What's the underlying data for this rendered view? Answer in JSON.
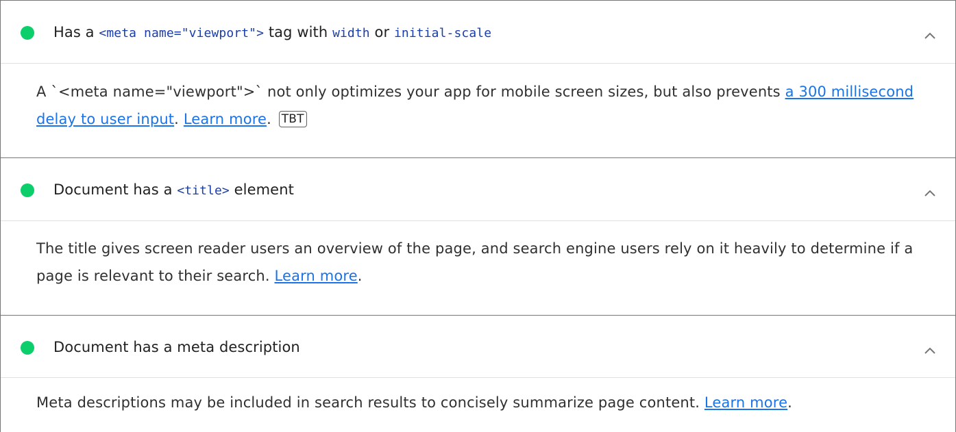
{
  "audits": [
    {
      "title_prefix": "Has a ",
      "title_code1": "<meta name=\"viewport\">",
      "title_middle": " tag with ",
      "title_code2": "width",
      "title_or": " or ",
      "title_code3": "initial-scale",
      "description_prefix": "A `<meta name=\"viewport\">` not only optimizes your app for mobile screen sizes, but also prevents ",
      "description_link1": "a 300 millisecond delay to user input",
      "description_sep": ". ",
      "learn_more": "Learn more",
      "description_end": ".",
      "badge": "TBT",
      "status_color": "#0cce6b",
      "expand_icon": "chevron-up-icon"
    },
    {
      "title_prefix": "Document has a ",
      "title_code1": "<title>",
      "title_suffix": " element",
      "description_prefix": "The title gives screen reader users an overview of the page, and search engine users rely on it heavily to determine if a page is relevant to their search. ",
      "learn_more": "Learn more",
      "description_end": ".",
      "status_color": "#0cce6b",
      "expand_icon": "chevron-up-icon"
    },
    {
      "title": "Document has a meta description",
      "description_prefix": "Meta descriptions may be included in search results to concisely summarize page content. ",
      "learn_more": "Learn more",
      "description_end": ".",
      "status_color": "#0cce6b",
      "expand_icon": "chevron-up-icon"
    }
  ],
  "colors": {
    "pass": "#0cce6b",
    "link": "#1a73e8",
    "code": "#1a3ea8"
  }
}
